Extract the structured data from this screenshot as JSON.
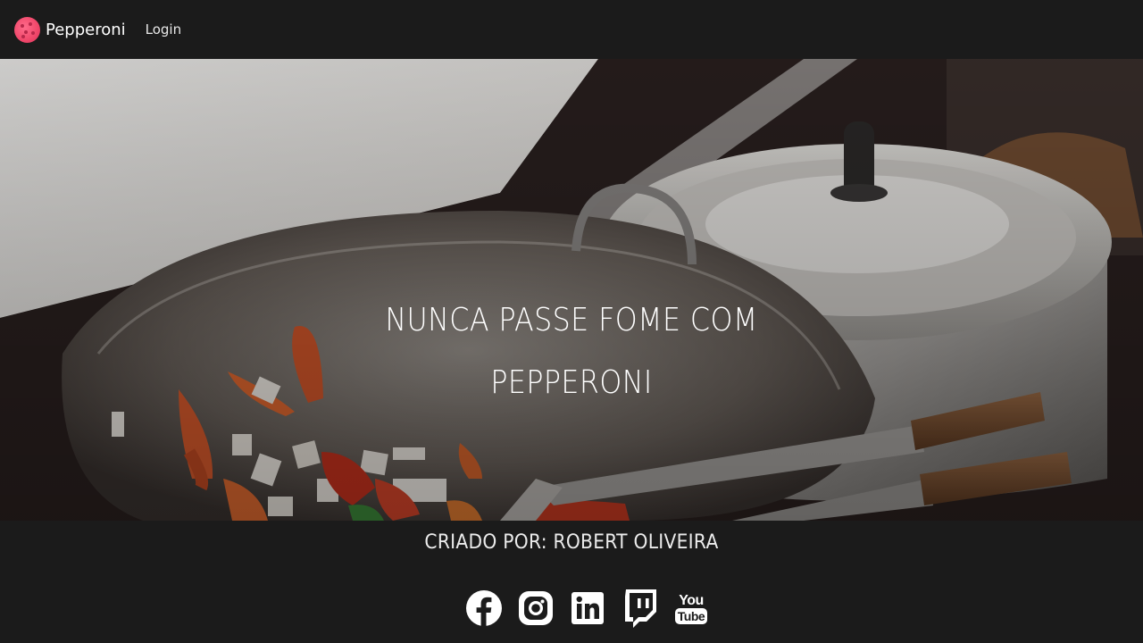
{
  "navbar": {
    "brand_name": "Pepperoni",
    "login_label": "Login",
    "logo_icon": "pepperoni-logo-icon",
    "logo_color": "#f0476a"
  },
  "hero": {
    "title_line1": "NUNCA PASSE FOME COM",
    "title_line2": "PEPPERONI",
    "background_image": "wok-cooking-vegetables-photo"
  },
  "footer": {
    "credit": "CRIADO POR: ROBERT OLIVEIRA",
    "youtube_text_top": "You",
    "youtube_text_bottom": "Tube",
    "social_icons": [
      "facebook-icon",
      "instagram-icon",
      "linkedin-icon",
      "twitch-icon",
      "youtube-icon"
    ]
  },
  "colors": {
    "background": "#1b1b1b",
    "text": "#ffffff"
  }
}
